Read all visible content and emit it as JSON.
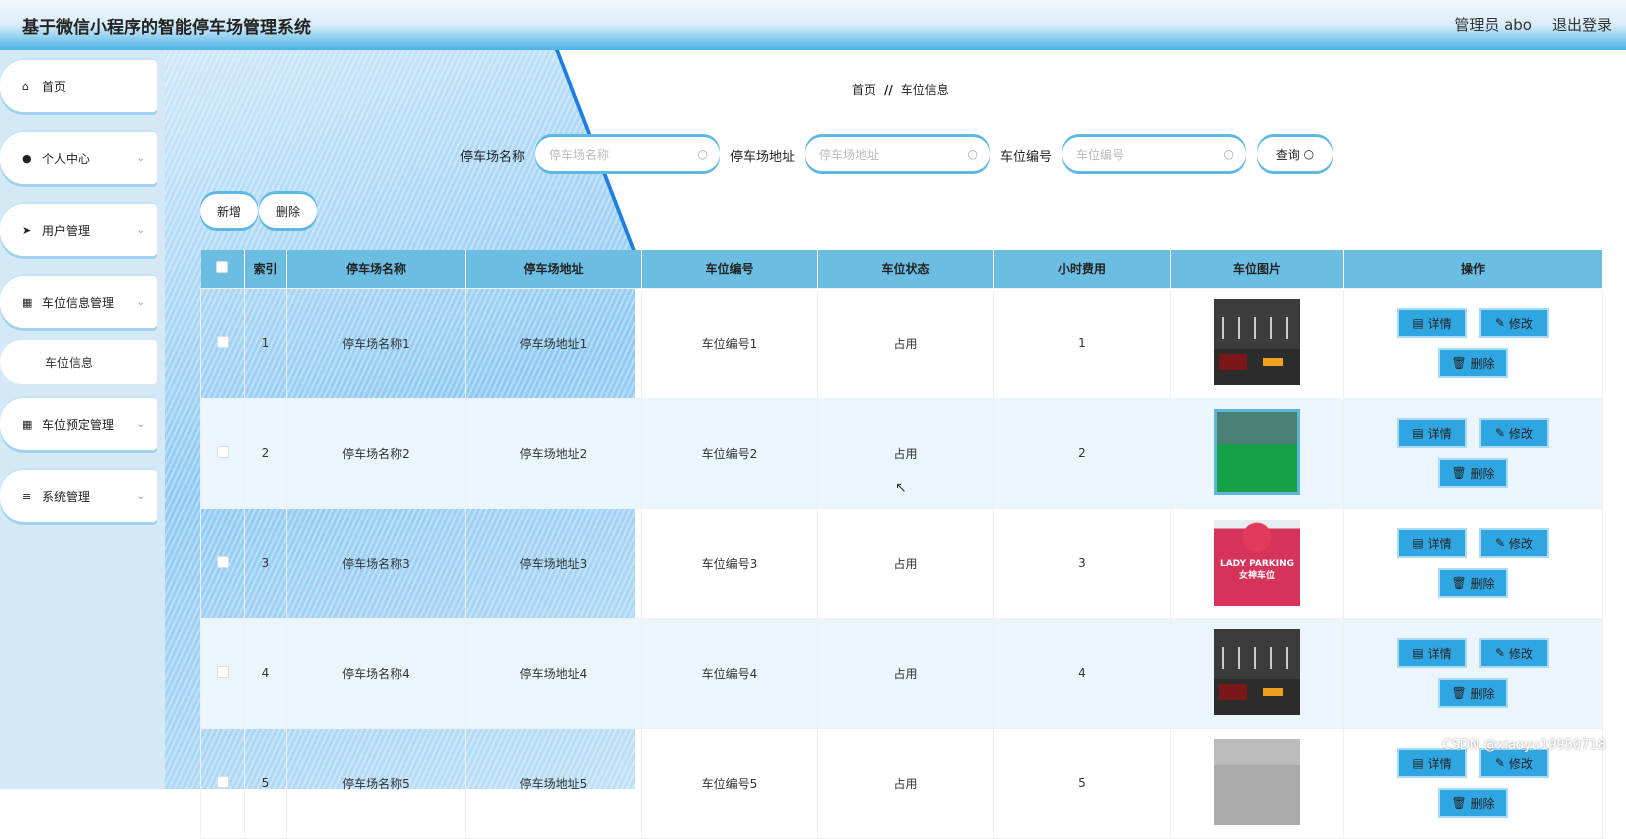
{
  "header": {
    "title": "基于微信小程序的智能停车场管理系统",
    "user": "管理员 abo",
    "logout": "退出登录"
  },
  "sidebar": {
    "items": [
      {
        "label": "首页",
        "icon": "home-icon",
        "glyph": "⌂"
      },
      {
        "label": "个人中心",
        "icon": "user-icon",
        "glyph": "●",
        "chevron": true
      },
      {
        "label": "用户管理",
        "icon": "send-icon",
        "glyph": "➤",
        "chevron": true
      },
      {
        "label": "车位信息管理",
        "icon": "grid-icon",
        "glyph": "▦",
        "chevron": true
      },
      {
        "label": "车位预定管理",
        "icon": "grid-icon",
        "glyph": "▦",
        "chevron": true
      },
      {
        "label": "系统管理",
        "icon": "menu-icon",
        "glyph": "≡",
        "chevron": true
      }
    ],
    "sub_item": "车位信息"
  },
  "breadcrumb": {
    "home": "首页",
    "sep": "//",
    "current": "车位信息"
  },
  "search": {
    "name_label": "停车场名称",
    "name_placeholder": "停车场名称",
    "addr_label": "停车场地址",
    "addr_placeholder": "停车场地址",
    "num_label": "车位编号",
    "num_placeholder": "车位编号",
    "query": "查询"
  },
  "actions": {
    "add": "新增",
    "delete": "删除"
  },
  "table": {
    "headers": [
      "索引",
      "停车场名称",
      "停车场地址",
      "车位编号",
      "车位状态",
      "小时费用",
      "车位图片",
      "操作"
    ],
    "rows": [
      {
        "index": "1",
        "name": "停车场名称1",
        "addr": "停车场地址1",
        "num": "车位编号1",
        "status": "占用",
        "fee": "1",
        "img": "t1"
      },
      {
        "index": "2",
        "name": "停车场名称2",
        "addr": "停车场地址2",
        "num": "车位编号2",
        "status": "占用",
        "fee": "2",
        "img": "t2"
      },
      {
        "index": "3",
        "name": "停车场名称3",
        "addr": "停车场地址3",
        "num": "车位编号3",
        "status": "占用",
        "fee": "3",
        "img": "t3"
      },
      {
        "index": "4",
        "name": "停车场名称4",
        "addr": "停车场地址4",
        "num": "车位编号4",
        "status": "占用",
        "fee": "4",
        "img": "t1"
      },
      {
        "index": "5",
        "name": "停车场名称5",
        "addr": "停车场地址5",
        "num": "车位编号5",
        "status": "占用",
        "fee": "5",
        "img": "t5"
      }
    ],
    "ops": {
      "detail": "详情",
      "edit": "修改",
      "delete": "删除"
    },
    "img3_text": "LADY PARKING 女神车位"
  },
  "watermark": "CSDN @xiaoyu19950718",
  "colors": {
    "accent": "#2fa5e2",
    "table_header": "#6cbde2"
  }
}
